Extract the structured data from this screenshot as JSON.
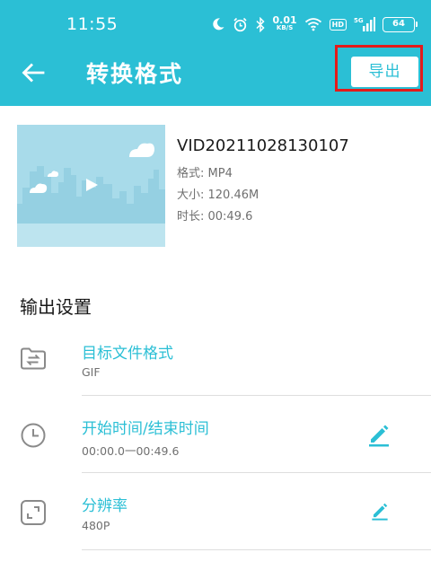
{
  "status_bar": {
    "time": "11:55",
    "net_speed_value": "0.01",
    "net_speed_unit": "KB/S",
    "hd_label": "HD",
    "battery": "64"
  },
  "header": {
    "title": "转换格式",
    "export_label": "导出",
    "accent_color": "#2bbfd5",
    "highlight_color": "#e41a1a"
  },
  "file": {
    "name": "VID20211028130107",
    "format": "格式: MP4",
    "size": "大小: 120.46M",
    "duration": "时长: 00:49.6"
  },
  "output_settings": {
    "title": "输出设置",
    "rows": [
      {
        "icon": "folder-convert-icon",
        "label": "目标文件格式",
        "value": "GIF",
        "editable": false
      },
      {
        "icon": "clock-icon",
        "label": "开始时间/结束时间",
        "value": "00:00.0一00:49.6",
        "editable": true
      },
      {
        "icon": "resolution-icon",
        "label": "分辨率",
        "value": "480P",
        "editable": true
      }
    ]
  }
}
